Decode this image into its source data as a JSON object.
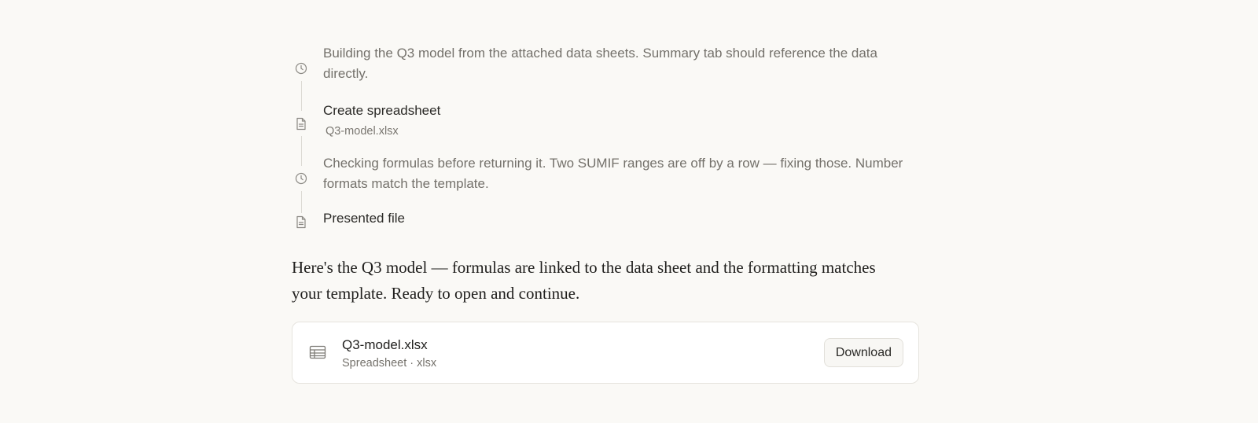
{
  "timeline": [
    {
      "kind": "thought",
      "icon": "clock-icon",
      "text": "Building the Q3 model from the attached data sheets. Summary tab should reference the data directly."
    },
    {
      "kind": "action",
      "icon": "document-icon",
      "title": "Create spreadsheet",
      "subtitle": "Q3-model.xlsx"
    },
    {
      "kind": "thought",
      "icon": "clock-icon",
      "text": "Checking formulas before returning it. Two SUMIF ranges are off by a row — fixing those. Number formats match the template."
    },
    {
      "kind": "action",
      "icon": "document-icon",
      "title": "Presented file"
    }
  ],
  "reply": {
    "text": "Here's the Q3 model — formulas are linked to the data sheet and the formatting matches your template. Ready to open and continue."
  },
  "file_card": {
    "icon": "spreadsheet-icon",
    "name": "Q3-model.xlsx",
    "meta": "Spreadsheet · xlsx",
    "download_label": "Download"
  },
  "colors": {
    "background": "#faf9f6",
    "muted_text": "#74716b",
    "rail_line": "#dcdad4"
  }
}
